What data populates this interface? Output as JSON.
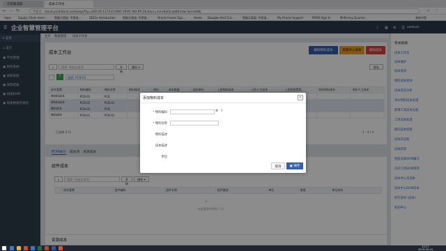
{
  "browser": {
    "tabs": [
      "云智集成器",
      "成本工作台"
    ],
    "secure_label": "不安全",
    "url": "cloud.yunhitech.com/wep/f?p=100:26:1173311995:3939::NO:RP,26:docs=1d-xEjVQ-ybK6xVwr3xrIvbWb",
    "bookmarks": [
      "Apps",
      "Supply Chain mem…",
      "智能方案说, 专家说…",
      "ODI2x Introduction",
      "智能方案说, 专家说…",
      "Oracle Fusion Sup…",
      "Home",
      "Douglas Visit Cus…",
      "智能方案说, 专家说…",
      "My Oracle Support",
      "PROD Sign In",
      "McKinsey Quarter…"
    ],
    "more_bookmarks": "其他书签"
  },
  "app": {
    "title": "企业智慧管理平台",
    "user": "venture",
    "header_icons": [
      "bell-icon",
      "calendar-icon",
      "user-icon",
      "settings-icon"
    ]
  },
  "sidebar": {
    "header": "菜单",
    "items": [
      "首页",
      "平台管理",
      "财务系统",
      "采购系统",
      "采购结账",
      "研发BOM",
      "研发数据可视化"
    ]
  },
  "breadcrumb": [
    "主页",
    "数据管理",
    "成本工作台"
  ],
  "main": {
    "title": "成本工作台",
    "toolbar": [
      "删除物料成本",
      "批量导入成本",
      "删除成本"
    ],
    "search_placeholder": "搜索: 所有文本列",
    "go_label": "开始",
    "actions_label": "操作",
    "save_label": "保存",
    "tree_label": "搜索: PCB-01",
    "columns": [
      "成本要素",
      "物料编码",
      "物料名称",
      "物料描述",
      "单位",
      "成本数量",
      "成本单价",
      "上阶物料成本",
      "上阶人工成本",
      "上阶制造费用",
      "本阶材料成本",
      "本阶人工成本"
    ],
    "rows": [
      [
        "原材料成本",
        "PCB-01",
        "PCB",
        "-",
        "-",
        "-"
      ],
      [
        "原材料成本",
        "PCB-02",
        "PCB-01",
        "-",
        "-",
        "-"
      ],
      [
        "物料成本",
        "PCB-02",
        "PCB",
        "-",
        "-",
        "-"
      ],
      [
        "物料成本",
        "PCB-01",
        "PCB-01",
        "-",
        "-",
        "-"
      ]
    ],
    "pager": "已选择 2 行",
    "pager_range": "1 - 4 / 4"
  },
  "detail": {
    "tabs": [
      "BOM展示",
      "成本项",
      "资源成本"
    ],
    "title": "组件成本",
    "search_placeholder": "搜索: 所有文本列",
    "go_label": "开始",
    "actions_label": "操作",
    "columns": [
      "成本要素",
      "组件编码",
      "组件名称",
      "组件描述",
      "单位",
      "数量",
      "单位成本"
    ],
    "empty_text": "在此报表中找到 1 行",
    "section3": "资源成本"
  },
  "right_panel": {
    "title": "有关报表",
    "items": [
      "成本工作台",
      "成本维护",
      "成本查询",
      "物料成本查询",
      "成本差异分析",
      "单价物料成本处理",
      "新增工资成本分配",
      "工单成本处理",
      "期间成本结账",
      "成本日记账",
      "成本结转",
      "制造成本BOM编号",
      "已开工单BOM清单",
      "成本中心月成本",
      "成本中心BOM成本",
      "库存查询 (成本)",
      "利润中心"
    ]
  },
  "modal": {
    "title": "添加物料成本",
    "fields": [
      {
        "label": "物料编码",
        "required": true
      },
      {
        "label": "物料名称",
        "required": true
      },
      {
        "label": "物料描述",
        "required": false
      },
      {
        "label": "成本描述",
        "required": false
      },
      {
        "label": "单位",
        "required": false
      }
    ],
    "cancel_label": "取消",
    "save_label": "保存"
  },
  "taskbar": {
    "time": "10:17",
    "date": "2019-09-10"
  },
  "colors": {
    "header_bg": "#2c3a4b",
    "btn_blue": "#3560ad",
    "btn_orange": "#f0a020",
    "btn_red": "#d9433a"
  }
}
